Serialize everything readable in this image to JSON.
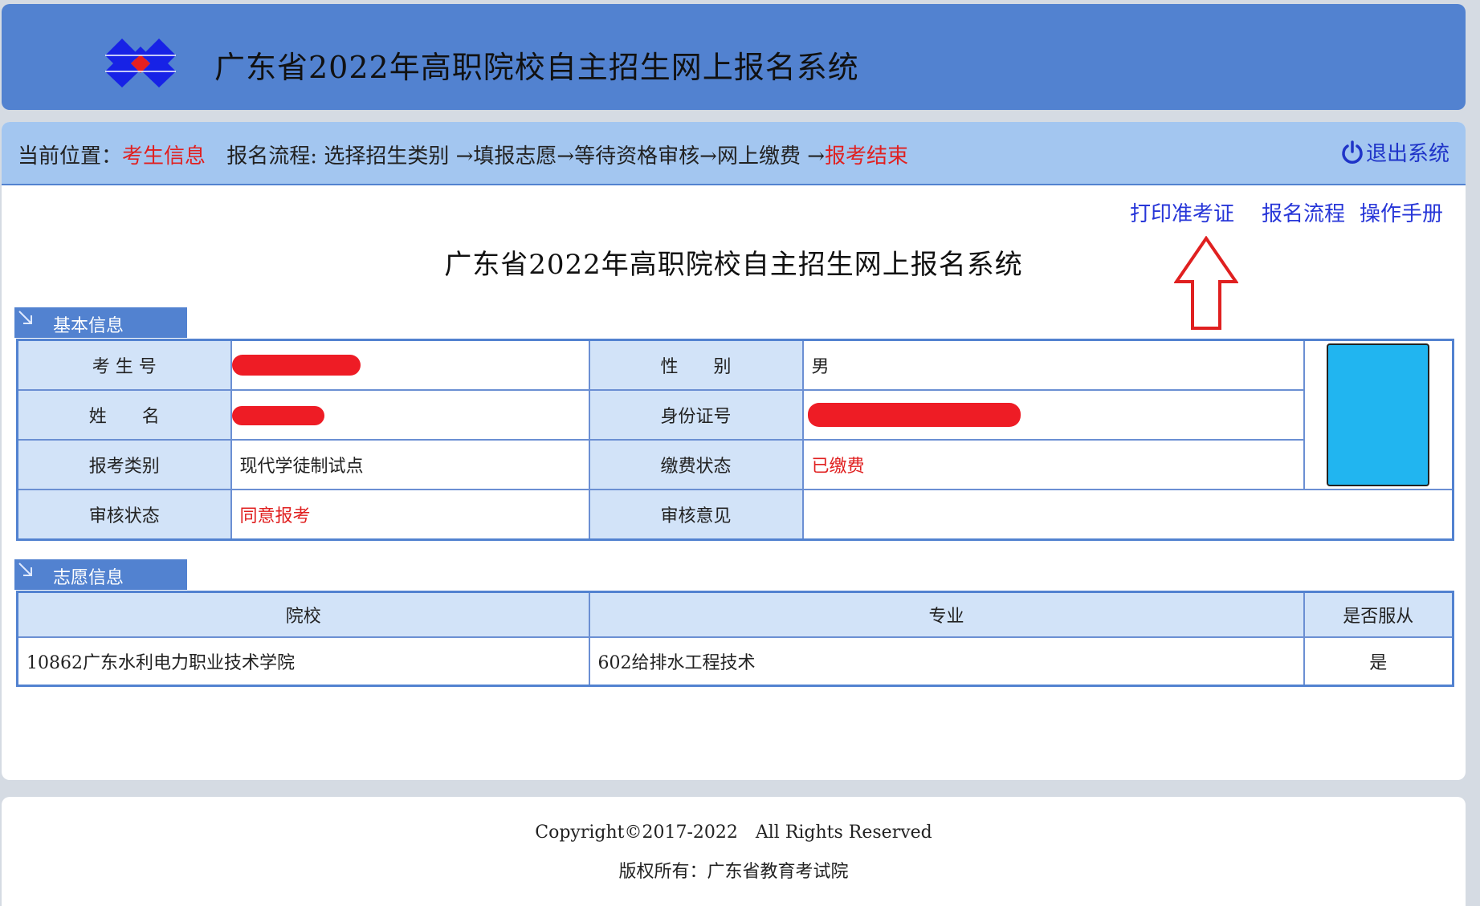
{
  "header": {
    "title": "广东省2022年高职院校自主招生网上报名系统"
  },
  "breadcrumb": {
    "label": "当前位置：",
    "current": "考生信息",
    "flow_label": "报名流程: ",
    "steps": "选择招生类别 →填报志愿→等待资格审核→网上缴费 →",
    "final_step": "报考结束",
    "logout": "退出系统"
  },
  "links": {
    "print_ticket": "打印准考证",
    "process": "报名流程",
    "manual": "操作手册"
  },
  "page_title": "广东省2022年高职院校自主招生网上报名系统",
  "basic_info": {
    "section_title": "基本信息",
    "exam_no_label": "考 生 号",
    "exam_no_value": "",
    "gender_label": "性　　别",
    "gender_value": "男",
    "name_label": "姓　　名",
    "name_value": "",
    "id_label": "身份证号",
    "id_value": "",
    "category_label": "报考类别",
    "category_value": "现代学徒制试点",
    "payment_label": "缴费状态",
    "payment_value": "已缴费",
    "review_status_label": "审核状态",
    "review_status_value": "同意报考",
    "review_opinion_label": "审核意见",
    "review_opinion_value": ""
  },
  "wish_info": {
    "section_title": "志愿信息",
    "headers": {
      "school": "院校",
      "major": "专业",
      "obey": "是否服从"
    },
    "rows": [
      {
        "school": "10862广东水利电力职业技术学院",
        "major": "602给排水工程技术",
        "obey": "是"
      }
    ]
  },
  "footer": {
    "copyright": "Copyright©2017-2022　All  Rights  Reserved",
    "owner": "版权所有：广东省教育考试院"
  },
  "colors": {
    "header_bg": "#5282d0",
    "breadcrumb_bg": "#a3c6f0",
    "label_cell_bg": "#d2e3f8",
    "highlight_red": "#e02020",
    "link_blue": "#2736d8",
    "redaction_red": "#ee1c25",
    "photo_blue": "#21b5f0"
  }
}
